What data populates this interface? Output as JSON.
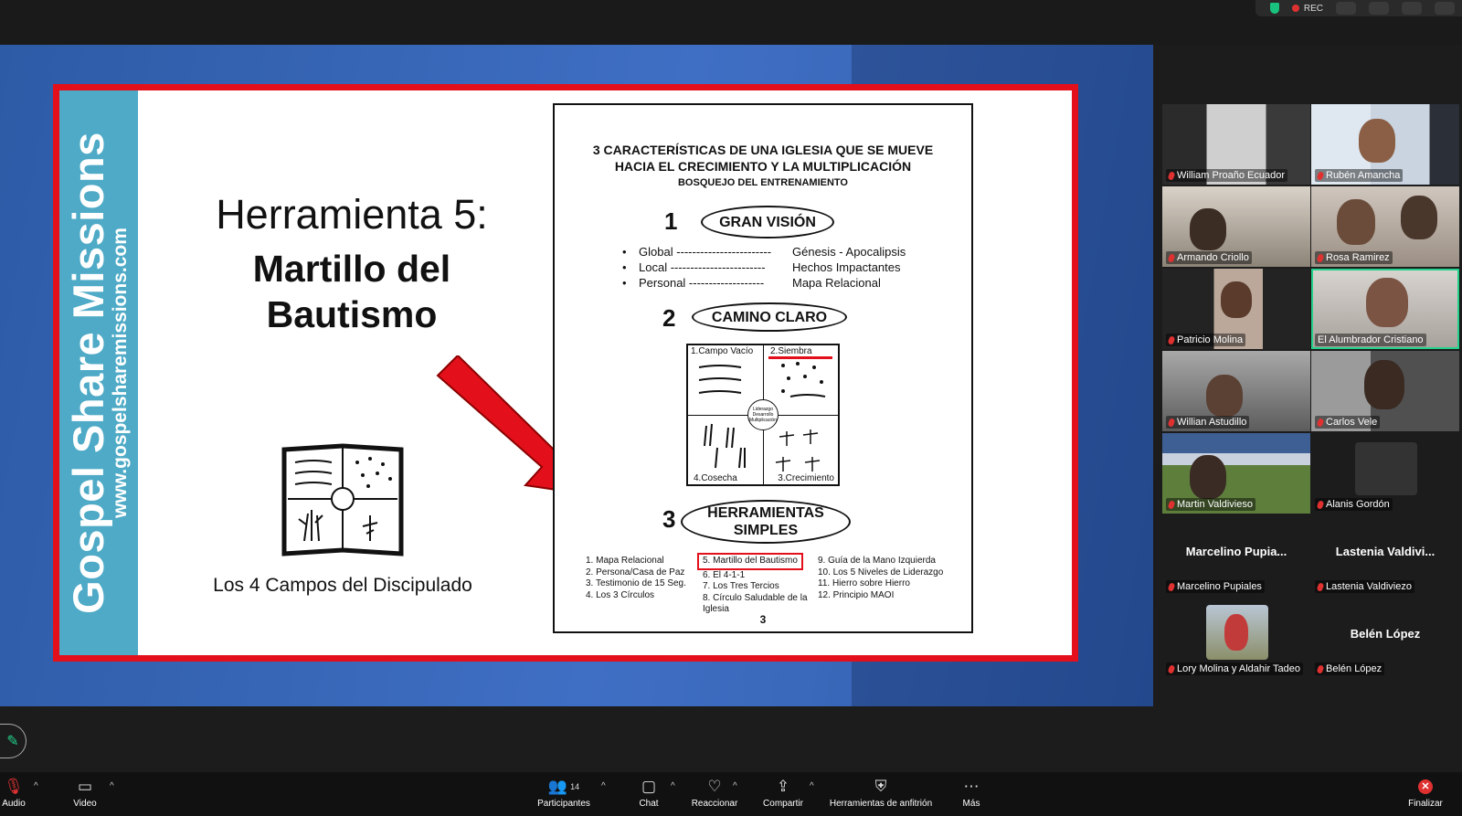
{
  "top": {
    "rec_label": "REC"
  },
  "slide": {
    "side_title": "Gospel Share Missions",
    "side_url": "www.gospelsharemissions.com",
    "tool_title": "Herramienta 5:",
    "tool_name_1": "Martillo del",
    "tool_name_2": "Bautismo",
    "book_caption": "Los 4 Campos del Discipulado",
    "page": {
      "title_1": "3 CARACTERÍSTICAS DE UNA IGLESIA QUE SE MUEVE",
      "title_2": "HACIA EL CRECIMIENTO Y LA MULTIPLICACIÓN",
      "subtitle": "BOSQUEJO DEL ENTRENAMIENTO",
      "sections": [
        {
          "num": "1",
          "label": "GRAN VISIÓN"
        },
        {
          "num": "2",
          "label": "CAMINO CLARO"
        },
        {
          "num": "3",
          "label": "HERRAMIENTAS SIMPLES"
        }
      ],
      "bullets": [
        {
          "key": "Global ------------------------",
          "value": "Génesis - Apocalipsis"
        },
        {
          "key": "Local ------------------------",
          "value": "Hechos Impactantes"
        },
        {
          "key": "Personal -------------------",
          "value": "Mapa Relacional"
        }
      ],
      "fields": {
        "q1": "1.Campo Vacío",
        "q2": "2.Siembra",
        "q3": "3.Crecimiento",
        "q4": "4.Cosecha",
        "center": "Liderazgo Desarrollo Multiplicación"
      },
      "tools_col1": [
        "1. Mapa Relacional",
        "2. Persona/Casa de Paz",
        "3. Testimonio de 15 Seg.",
        "4. Los 3 Círculos"
      ],
      "tools_col2_highlight": "5. Martillo del Bautismo",
      "tools_col2": [
        "6. El 4-1-1",
        "7. Los Tres Tercios",
        "8. Círculo Saludable de la",
        "Iglesia"
      ],
      "tools_col3": [
        "9. Guía de la Mano Izquierda",
        "10. Los 5 Niveles de Liderazgo",
        "11. Hierro sobre Hierro",
        "12. Principio MAOI"
      ],
      "page_number": "3"
    }
  },
  "participants": [
    {
      "name": "William Proaño Ecuador"
    },
    {
      "name": "Rubén Amancha"
    },
    {
      "name": "Armando Criollo"
    },
    {
      "name": "Rosa Ramirez"
    },
    {
      "name": "Patricio Molina"
    },
    {
      "name": "El Alumbrador Cristiano"
    },
    {
      "name": "Willian Astudillo"
    },
    {
      "name": "Carlos Vele"
    },
    {
      "name": "Martin Valdivieso"
    },
    {
      "name": "Alanis Gordón"
    },
    {
      "name": "Marcelino Pupiales",
      "display": "Marcelino  Pupia..."
    },
    {
      "name": "Lastenia Valdiviezo",
      "display": "Lastenia  Valdivi..."
    },
    {
      "name": "Lory Molina y Aldahir Tadeo"
    },
    {
      "name": "Belén López",
      "display": "Belén López"
    }
  ],
  "toolbar": {
    "audio": "Audio",
    "video": "Video",
    "participants": "Participantes",
    "participant_count": "14",
    "chat": "Chat",
    "react": "Reaccionar",
    "share": "Compartir",
    "host_tools": "Herramientas de anfitrión",
    "more": "Más",
    "end": "Finalizar"
  },
  "colors": {
    "slide_border": "#e3101b",
    "side_band": "#4eaac6",
    "active_speaker": "#23d18b",
    "muted_mic": "#e03131"
  }
}
